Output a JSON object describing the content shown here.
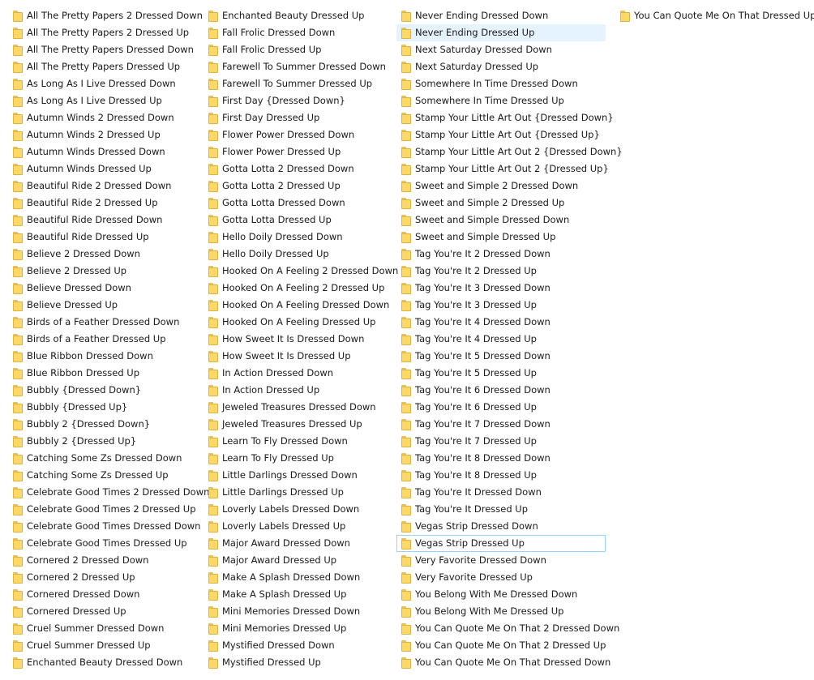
{
  "file_list": {
    "columns": [
      {
        "items": [
          "All The Pretty Papers 2 Dressed Down",
          "All The Pretty Papers 2 Dressed Up",
          "All The Pretty Papers Dressed Down",
          "All The Pretty Papers Dressed Up",
          "As Long As I Live Dressed Down",
          "As Long As I Live Dressed Up",
          "Autumn Winds 2 Dressed Down",
          "Autumn Winds 2 Dressed Up",
          "Autumn Winds Dressed Down",
          "Autumn Winds Dressed Up",
          "Beautiful Ride 2 Dressed Down",
          "Beautiful Ride 2 Dressed Up",
          "Beautiful Ride Dressed Down",
          "Beautiful Ride Dressed Up",
          "Believe 2 Dressed Down",
          "Believe 2 Dressed Up",
          "Believe Dressed Down",
          "Believe Dressed Up",
          "Birds of a Feather Dressed Down",
          "Birds of a Feather Dressed Up",
          "Blue Ribbon Dressed Down",
          "Blue Ribbon Dressed Up",
          "Bubbly {Dressed Down}",
          "Bubbly {Dressed Up}",
          "Bubbly 2 {Dressed Down}",
          "Bubbly 2 {Dressed Up}",
          "Catching Some Zs Dressed Down",
          "Catching Some Zs Dressed Up",
          "Celebrate Good Times 2 Dressed Down",
          "Celebrate Good Times 2 Dressed Up",
          "Celebrate Good Times Dressed Down",
          "Celebrate Good Times Dressed Up",
          "Cornered 2 Dressed Down",
          "Cornered 2 Dressed Up",
          "Cornered Dressed Down",
          "Cornered Dressed Up",
          "Cruel Summer Dressed Down",
          "Cruel Summer Dressed Up",
          "Enchanted Beauty Dressed Down"
        ]
      },
      {
        "items": [
          "Enchanted Beauty Dressed Up",
          "Fall Frolic Dressed Down",
          "Fall Frolic Dressed Up",
          "Farewell To Summer Dressed Down",
          "Farewell To Summer Dressed Up",
          "First Day {Dressed Down}",
          "First Day Dressed Up",
          "Flower Power Dressed Down",
          "Flower Power Dressed Up",
          "Gotta Lotta 2 Dressed Down",
          "Gotta Lotta 2 Dressed Up",
          "Gotta Lotta Dressed Down",
          "Gotta Lotta Dressed Up",
          "Hello Doily Dressed Down",
          "Hello Doily Dressed Up",
          "Hooked On A Feeling 2 Dressed Down",
          "Hooked On A Feeling 2 Dressed Up",
          "Hooked On A Feeling Dressed Down",
          "Hooked On A Feeling Dressed Up",
          "How Sweet It Is Dressed Down",
          "How Sweet It Is Dressed Up",
          "In Action Dressed Down",
          "In Action Dressed Up",
          "Jeweled Treasures Dressed Down",
          "Jeweled Treasures Dressed Up",
          "Learn To Fly Dressed Down",
          "Learn To Fly Dressed Up",
          "Little Darlings Dressed Down",
          "Little Darlings Dressed Up",
          "Loverly Labels Dressed Down",
          "Loverly Labels Dressed Up",
          "Major Award Dressed Down",
          "Major Award Dressed Up",
          "Make A Splash Dressed Down",
          "Make A Splash Dressed Up",
          "Mini Memories Dressed Down",
          "Mini Memories Dressed Up",
          "Mystified Dressed Down",
          "Mystified Dressed Up"
        ]
      },
      {
        "items": [
          "Never Ending Dressed Down",
          "Never Ending Dressed Up",
          "Next Saturday Dressed Down",
          "Next Saturday Dressed Up",
          "Somewhere In Time Dressed Down",
          "Somewhere In Time Dressed Up",
          "Stamp Your Little Art Out {Dressed Down}",
          "Stamp Your Little Art Out {Dressed Up}",
          "Stamp Your Little Art Out 2 {Dressed Down}",
          "Stamp Your Little Art Out 2 {Dressed Up}",
          "Sweet and Simple 2 Dressed Down",
          "Sweet and Simple 2 Dressed Up",
          "Sweet and Simple Dressed Down",
          "Sweet and Simple Dressed Up",
          "Tag You're It 2 Dressed Down",
          "Tag You're It 2 Dressed Up",
          "Tag You're It 3 Dressed Down",
          "Tag You're It 3 Dressed Up",
          "Tag You're It 4 Dressed Down",
          "Tag You're It 4 Dressed Up",
          "Tag You're It 5 Dressed Down",
          "Tag You're It 5 Dressed Up",
          "Tag You're It 6 Dressed Down",
          "Tag You're It 6 Dressed Up",
          "Tag You're It 7 Dressed Down",
          "Tag You're It 7 Dressed Up",
          "Tag You're It 8 Dressed Down",
          "Tag You're It 8 Dressed Up",
          "Tag You're It Dressed Down",
          "Tag You're It Dressed Up",
          "Vegas Strip Dressed Down",
          "Vegas Strip Dressed Up",
          "Very Favorite Dressed Down",
          "Very Favorite Dressed Up",
          "You Belong With Me Dressed Down",
          "You Belong With Me Dressed Up",
          "You Can Quote Me On That 2 Dressed Down",
          "You Can Quote Me On That 2 Dressed Up",
          "You Can Quote Me On That Dressed Down"
        ]
      },
      {
        "items": [
          "You Can Quote Me On That Dressed Up"
        ]
      }
    ],
    "hovered_item": "Never Ending Dressed Up",
    "focused_item": "Vegas Strip Dressed Up",
    "icon": "folder-icon",
    "colors": {
      "hover_bg": "#e5f3ff",
      "focus_border": "#99d1ff",
      "folder_fill": "#fcd869"
    }
  }
}
